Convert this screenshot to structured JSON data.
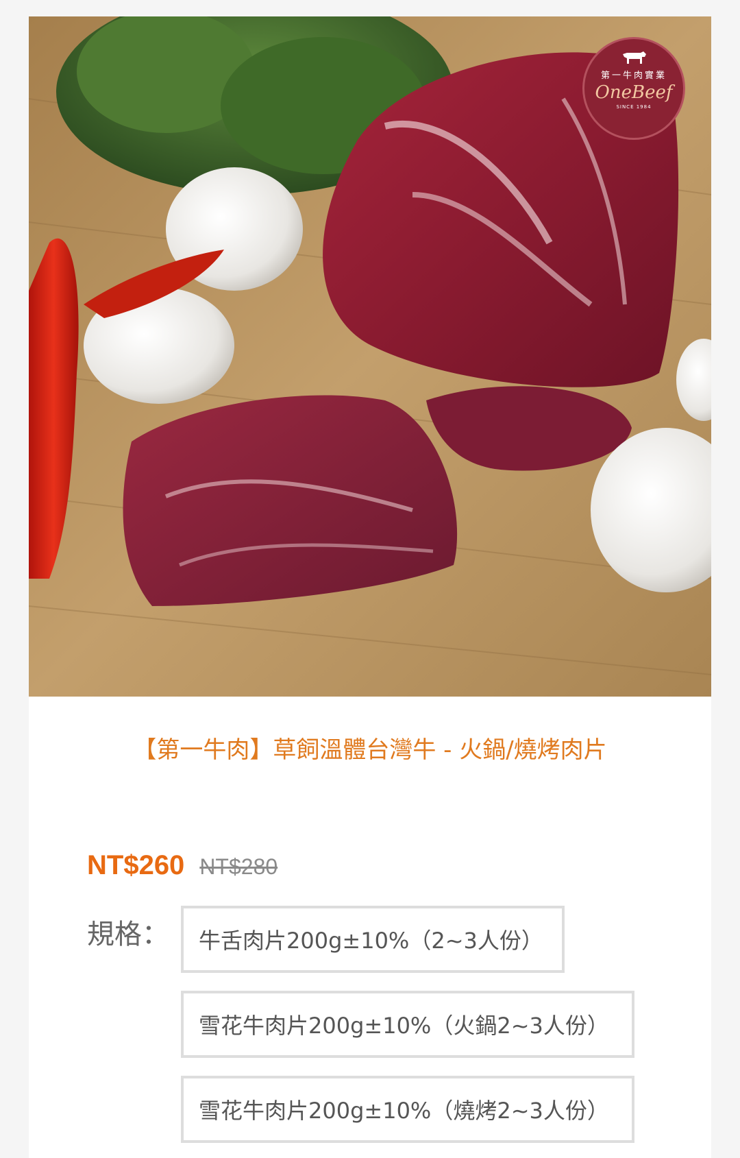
{
  "product": {
    "image_alt": "grass-fed beef slices with broccoli, garlic and chili",
    "logo": {
      "subtitle": "第一牛肉實業",
      "brand": "OneBeef",
      "since": "SINCE 1984"
    },
    "title": "【第一牛肉】草飼溫體台灣牛 - 火鍋/燒烤肉片",
    "price": {
      "sale": "NT$260",
      "original": "NT$280"
    },
    "spec": {
      "label": "規格：",
      "options": [
        {
          "label": "牛舌肉片200g±10%（2~3人份）"
        },
        {
          "label": "雪花牛肉片200g±10%（火鍋2~3人份）"
        },
        {
          "label": "雪花牛肉片200g±10%（燒烤2~3人份）"
        }
      ]
    },
    "colors": {
      "title": "#e07a1f",
      "sale_price": "#e86a12",
      "logo_bg": "#8a2233"
    }
  }
}
